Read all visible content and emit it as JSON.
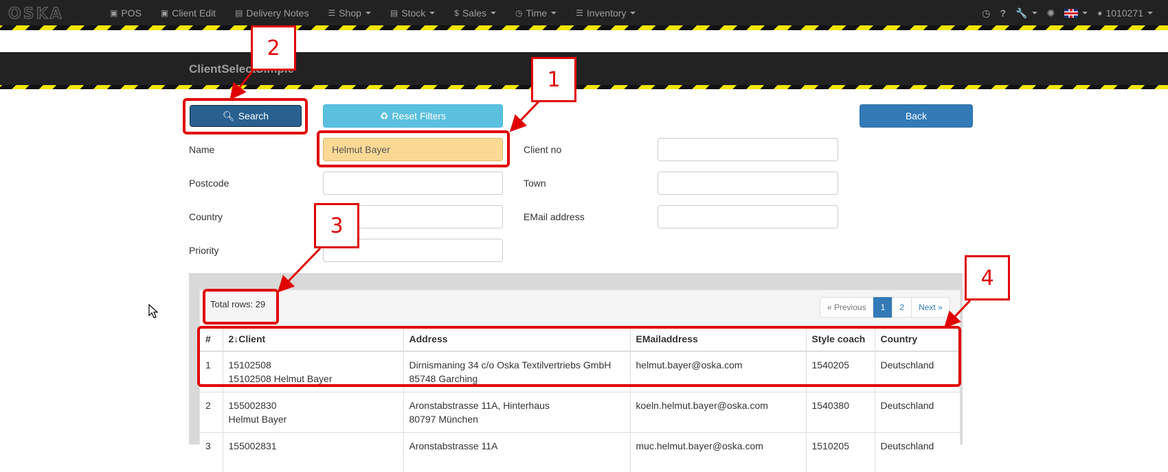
{
  "navbar": {
    "logo": "OSKA",
    "items": [
      {
        "label": "POS",
        "icon": "shopping-bag-icon",
        "glyph": "🛍",
        "dropdown": false
      },
      {
        "label": "Client Edit",
        "icon": "contact-card-icon",
        "glyph": "▣",
        "dropdown": false
      },
      {
        "label": "Delivery Notes",
        "icon": "inbox-icon",
        "glyph": "▤",
        "dropdown": false
      },
      {
        "label": "Shop",
        "icon": "sliders-icon",
        "glyph": "☰",
        "dropdown": true
      },
      {
        "label": "Stock",
        "icon": "archive-icon",
        "glyph": "▤",
        "dropdown": true
      },
      {
        "label": "Sales",
        "icon": "dollar-icon",
        "glyph": "$",
        "dropdown": true
      },
      {
        "label": "Time",
        "icon": "clock-icon",
        "glyph": "◷",
        "dropdown": true
      },
      {
        "label": "Inventory",
        "icon": "list-icon",
        "glyph": "☰",
        "dropdown": true
      }
    ],
    "right": {
      "user": "1010271"
    }
  },
  "header": {
    "title": "ClientSelectSimple"
  },
  "buttons": {
    "search": "Search",
    "reset": "Reset Filters",
    "back": "Back"
  },
  "form": {
    "name_label": "Name",
    "name_value": "Helmut Bayer",
    "client_no_label": "Client no",
    "client_no_value": "",
    "postcode_label": "Postcode",
    "postcode_value": "",
    "town_label": "Town",
    "town_value": "",
    "country_label": "Country",
    "country_value": "",
    "email_label": "EMail address",
    "email_value": "",
    "priority_label": "Priority",
    "priority_value": ""
  },
  "results": {
    "total_rows": "Total rows: 29",
    "pager": {
      "previous": "« Previous",
      "pages": [
        "1",
        "2"
      ],
      "active": "1",
      "next": "Next »"
    },
    "columns": [
      "#",
      "2↓Client",
      "Address",
      "EMailaddress",
      "Style coach",
      "Country"
    ],
    "rows": [
      {
        "num": "1",
        "client1": "15102508",
        "client2": "15102508 Helmut Bayer",
        "addr1": "Dirnismaning 34 c/o Oska Textilvertriebs GmbH",
        "addr2": "85748 Garching",
        "email": "helmut.bayer@oska.com",
        "coach": "1540205",
        "country": "Deutschland"
      },
      {
        "num": "2",
        "client1": "155002830",
        "client2": "Helmut Bayer",
        "addr1": "Aronstabstrasse 11A, Hinterhaus",
        "addr2": "80797 München",
        "email": "koeln.helmut.bayer@oska.com",
        "coach": "1540380",
        "country": "Deutschland"
      },
      {
        "num": "3",
        "client1": "155002831",
        "client2": "",
        "addr1": "Aronstabstrasse 11A",
        "addr2": "",
        "email": "muc.helmut.bayer@oska.com",
        "coach": "1510205",
        "country": "Deutschland"
      }
    ]
  },
  "annotations": {
    "callouts": [
      "1",
      "2",
      "3",
      "4"
    ],
    "color": "#e00000"
  },
  "colors": {
    "navbar_bg": "#222222",
    "stripe_yellow": "#f2e600",
    "primary_button": "#286090",
    "info_button": "#5bc0de",
    "back_button": "#337ab7",
    "highlighted_input": "#fbd995"
  }
}
